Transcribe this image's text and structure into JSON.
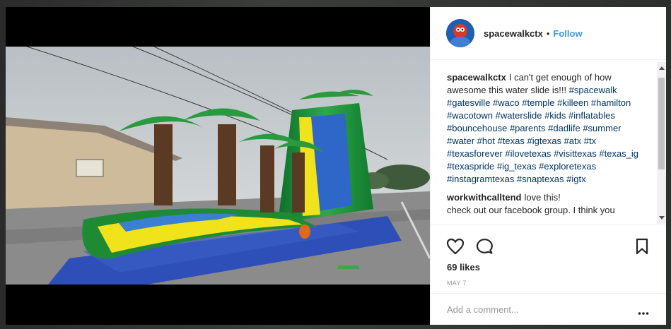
{
  "post": {
    "username": "spacewalkctx",
    "separator": "•",
    "follow_label": "Follow",
    "caption_user": "spacewalkctx",
    "caption_text": "I can't get enough of how awesome this water slide is!!!",
    "hashtags": [
      "#spacewalk",
      "#gatesville",
      "#waco",
      "#temple",
      "#killeen",
      "#hamilton",
      "#wacotown",
      "#waterslide",
      "#kids",
      "#inflatables",
      "#bouncehouse",
      "#parents",
      "#dadlife",
      "#summer",
      "#water",
      "#hot",
      "#texas",
      "#igtexas",
      "#atx",
      "#tx",
      "#texasforever",
      "#ilovetexas",
      "#visittexas",
      "#texas_ig",
      "#texaspride",
      "#ig_texas",
      "#exploretexas",
      "#instagramtexas",
      "#snaptexas",
      "#igtx"
    ],
    "comment2_user": "workwithcalltend",
    "comment2_line1": "love this!",
    "comment2_line2": "check out our facebook group. I think you",
    "likes": "69 likes",
    "date": "MAY 7",
    "comment_placeholder": "Add a comment...",
    "more_label": "•••"
  },
  "icons": {
    "like": "heart-icon",
    "comment": "comment-icon",
    "save": "bookmark-icon",
    "more": "more-icon"
  },
  "colors": {
    "link": "#3897f0",
    "hashtag": "#003569",
    "text": "#262626"
  }
}
